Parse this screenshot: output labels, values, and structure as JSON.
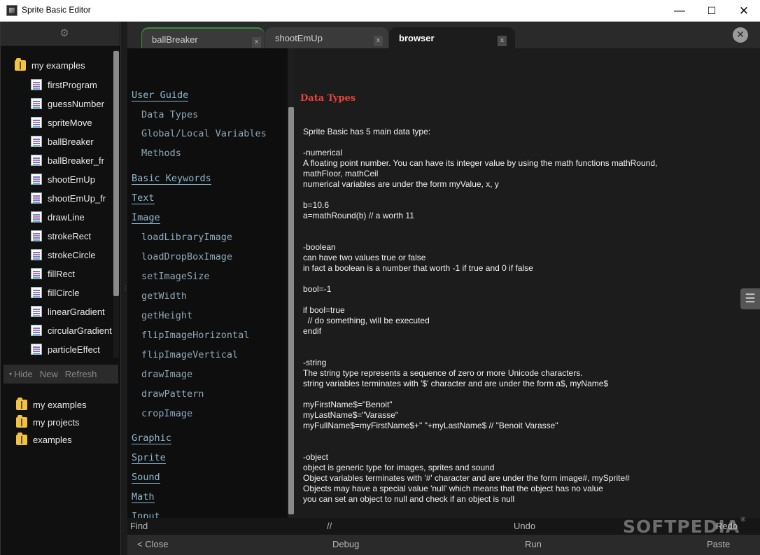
{
  "window": {
    "title": "Sprite Basic Editor",
    "minimize": "—",
    "maximize": "☐",
    "close": "✕"
  },
  "sidebar": {
    "gear_glyph": "⚙",
    "root_label": "my examples",
    "files": [
      "firstProgram",
      "guessNumber",
      "spriteMove",
      "ballBreaker",
      "ballBreaker_fr",
      "shootEmUp",
      "shootEmUp_fr",
      "drawLine",
      "strokeRect",
      "strokeCircle",
      "fillRect",
      "fillCircle",
      "linearGradient",
      "circularGradient",
      "particleEffect"
    ],
    "actions": {
      "caret": "▾",
      "hide": "Hide",
      "new": "New",
      "refresh": "Refresh"
    },
    "folders": [
      "my examples",
      "my projects",
      "examples"
    ]
  },
  "tabs": [
    {
      "label": "ballBreaker",
      "close": "x"
    },
    {
      "label": "shootEmUp",
      "close": "x"
    },
    {
      "label": "browser",
      "close": "x"
    }
  ],
  "close_all_glyph": "✕",
  "toc": {
    "user_guide": "User Guide",
    "guide_items": [
      "Data Types",
      "Global/Local Variables",
      "Methods"
    ],
    "basic_keywords": "Basic Keywords",
    "text": "Text",
    "image": "Image",
    "image_items": [
      "loadLibraryImage",
      "loadDropBoxImage",
      "setImageSize",
      "getWidth",
      "getHeight",
      "flipImageHorizontal",
      "flipImageVertical",
      "drawImage",
      "drawPattern",
      "cropImage"
    ],
    "graphic": "Graphic",
    "sprite": "Sprite",
    "sound": "Sound",
    "math": "Math",
    "input": "Input"
  },
  "content": {
    "title": "Data Types",
    "lines": [
      "Sprite Basic has 5 main data type:",
      "-numerical",
      "A floating point number. You can have its integer value by using the math functions mathRound,",
      "mathFloor, mathCeil",
      "numerical variables are under the form myValue, x, y",
      "b=10.6",
      "a=mathRound(b) // a worth 11",
      "-boolean",
      "can have two values true or false",
      "in fact a boolean is a number that worth -1 if true and 0 if false",
      "bool=-1",
      "if bool=true",
      "  // do something, will be executed",
      "endif",
      "-string",
      "The string type represents a sequence of zero or more Unicode characters.",
      "string variables terminates with '$' character and are under the form a$, myName$",
      "myFirstName$=\"Benoit\"",
      "myLastName$=\"Varasse\"",
      "myFullName$=myFirstName$+\" \"+myLastName$ // \"Benoit Varasse\"",
      "-object",
      "object is generic type for images, sprites and sound",
      "Object variables terminates with '#' character and are under the form image#, mySprite#",
      "Objects may have a special value 'null' which means that the object has no value",
      "you can set an object to null and check if an object is null"
    ]
  },
  "menu_glyph": "☰",
  "toolbar": {
    "find": "Find",
    "comment": "//",
    "undo": "Undo",
    "redo": "Redo",
    "close": "< Close",
    "debug": "Debug",
    "run": "Run",
    "paste": "Paste"
  },
  "watermark": {
    "text": "SOFTPEDIA",
    "mark": "®"
  }
}
